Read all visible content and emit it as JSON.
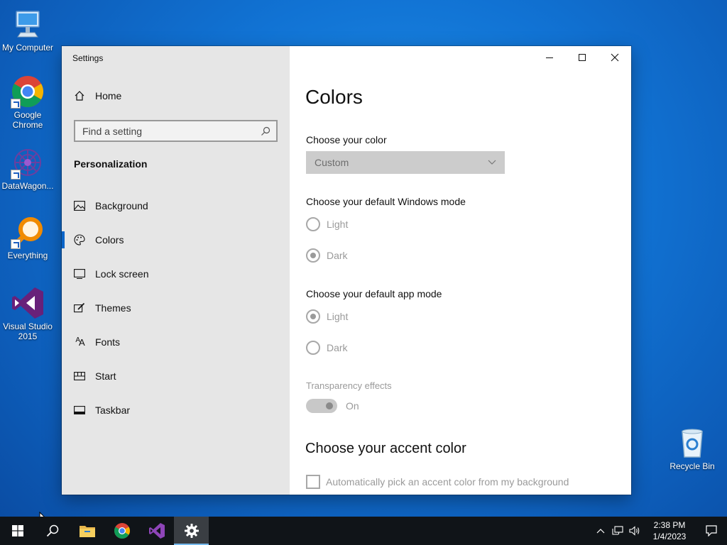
{
  "desktop": {
    "icons": [
      {
        "label": "My Computer"
      },
      {
        "label": "Google Chrome"
      },
      {
        "label": "DataWagon..."
      },
      {
        "label": "Everything"
      },
      {
        "label": "Visual Studio 2015"
      },
      {
        "label": "Recycle Bin"
      }
    ]
  },
  "window": {
    "title": "Settings",
    "controls": {
      "minimize": "minimize-icon",
      "maximize": "maximize-icon",
      "close": "close-icon"
    }
  },
  "nav": {
    "home_label": "Home",
    "search_placeholder": "Find a setting",
    "section": "Personalization",
    "items": [
      {
        "label": "Background",
        "icon": "picture-icon"
      },
      {
        "label": "Colors",
        "icon": "palette-icon",
        "active": true
      },
      {
        "label": "Lock screen",
        "icon": "lock-screen-icon"
      },
      {
        "label": "Themes",
        "icon": "themes-brush-icon"
      },
      {
        "label": "Fonts",
        "icon": "fonts-icon"
      },
      {
        "label": "Start",
        "icon": "start-icon"
      },
      {
        "label": "Taskbar",
        "icon": "taskbar-icon"
      }
    ]
  },
  "content": {
    "title": "Colors",
    "choose_color_label": "Choose your color",
    "choose_color_value": "Custom",
    "windows_mode_label": "Choose your default Windows mode",
    "windows_mode_options": [
      {
        "label": "Light",
        "selected": false
      },
      {
        "label": "Dark",
        "selected": true
      }
    ],
    "app_mode_label": "Choose your default app mode",
    "app_mode_options": [
      {
        "label": "Light",
        "selected": true
      },
      {
        "label": "Dark",
        "selected": false
      }
    ],
    "transparency_label": "Transparency effects",
    "transparency_state": "On",
    "accent_heading": "Choose your accent color",
    "auto_accent_label": "Automatically pick an accent color from my background"
  },
  "taskbar": {
    "apps": [
      "start-icon",
      "search-icon",
      "file-explorer-icon",
      "chrome-icon",
      "visual-studio-icon",
      "settings-gear-icon"
    ],
    "clock_time": "2:38 PM",
    "clock_date": "1/4/2023"
  },
  "colors": {
    "accent": "#0a64c8",
    "desktop": "#1173d4",
    "taskbar": "#101418"
  }
}
